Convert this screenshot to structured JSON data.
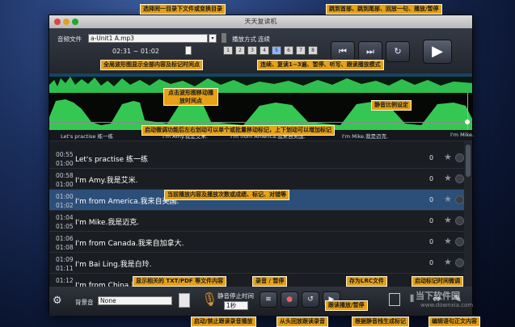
{
  "window": {
    "title": "天天复读机"
  },
  "controls": {
    "file_label": "音频文件",
    "file_value": "a-Unit1 A.mp3",
    "play_mode_label": "播放方式",
    "play_mode_value": "连续",
    "time_range": "02:31 ~ 01:02",
    "mode_buttons": [
      "1",
      "2",
      "3",
      "4",
      "5",
      "6",
      "7",
      "8"
    ],
    "btn_first": "⏮",
    "btn_next": "⏭",
    "btn_loop": "↻",
    "btn_play": "▶"
  },
  "marks": [
    "Let's practise 练一练",
    "I'm Amy.我是艾米.",
    "I'm from America.我来自美国.",
    "I'm Mike.我是迈克.",
    "I'm Mike."
  ],
  "rows": [
    {
      "start": "00:55",
      "end": "01:00",
      "text": "Let's practise 练一练",
      "count": "0"
    },
    {
      "start": "00:58",
      "end": "01:00",
      "text": "I'm Amy.我是艾米.",
      "count": "0"
    },
    {
      "start": "01:00",
      "end": "01:02",
      "text": "I'm from America.我来自美国.",
      "count": "0"
    },
    {
      "start": "01:04",
      "end": "01:05",
      "text": "I'm Mike.我是迈克.",
      "count": "0"
    },
    {
      "start": "01:06",
      "end": "01:08",
      "text": "I'm from Canada.我来自加拿大.",
      "count": "0"
    },
    {
      "start": "01:09",
      "end": "01:11",
      "text": "I'm Bai Ling.我是白玲.",
      "count": "0"
    },
    {
      "start": "01:12",
      "end": "",
      "text": "I'm from China.我来自中国.",
      "count": "0"
    }
  ],
  "bottom": {
    "bgm_label": "背景音",
    "bgm_value": "None",
    "pause_label": "静音停止时间",
    "pause_value": "1秒"
  },
  "annotations": {
    "a1": "选择同一目录下文件或变换目录",
    "a2": "跳到首部、跳到尾部、回放一句、播放/暂停",
    "a3": "全局波形图显示全部内容及标记时间点",
    "a4": "连续、复读1~3遍、暂停、听写、跟读播放模式",
    "a5": "点击波形图移动播放时间点",
    "a6": "静音比例设定",
    "a7": "启动微调功能后左右划动可以单个或批量移动标记，上下划动可以增加标记",
    "a8": "当前播放内容及播放次数或成绩、标记、对错等",
    "a9": "显示相关的 TXT/PDF 等文件内容",
    "a10": "录音 / 暂停",
    "a11": "存为LRC文件",
    "a12": "启动标记时间微调",
    "a13": "启动/禁止跟读录音播放",
    "a14": "从头回放跟读录音",
    "a15": "根据静音栈生成标记",
    "a16": "编辑语句正文内容",
    "a17": "跟读播放/暂停"
  },
  "watermark": {
    "text": "当下软件园",
    "url": "www.downxia.com"
  }
}
